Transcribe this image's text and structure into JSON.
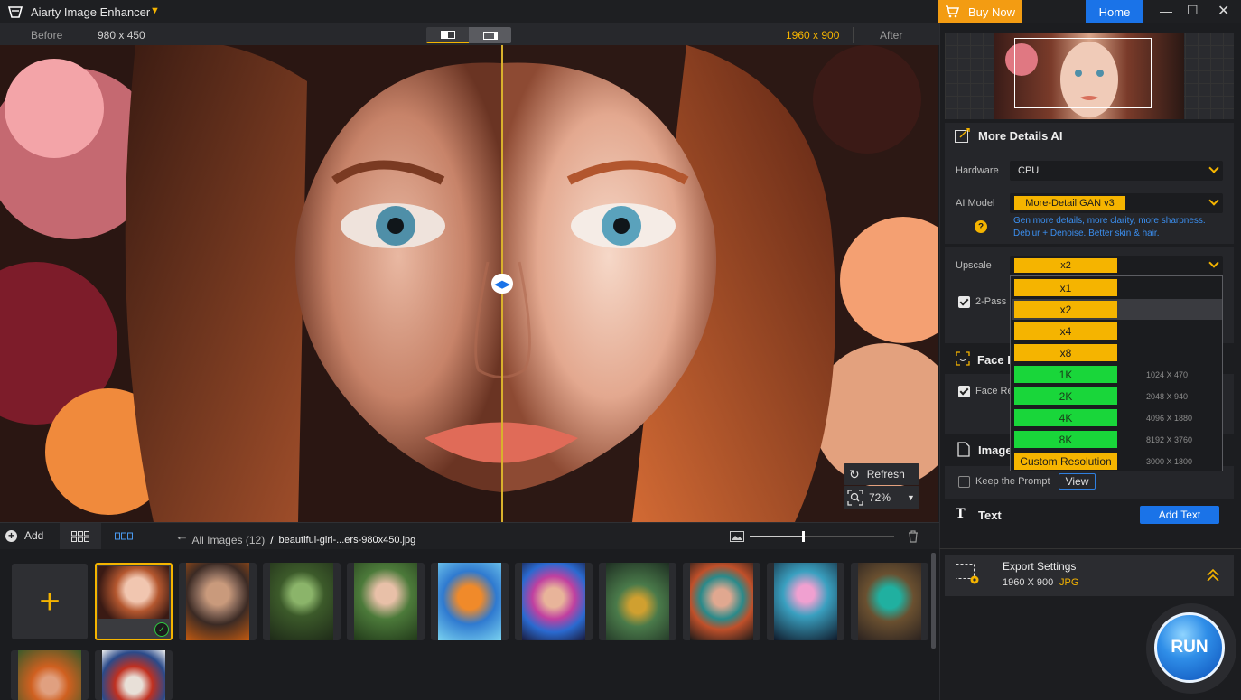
{
  "app": {
    "title": "Aiarty Image Enhancer"
  },
  "topbar": {
    "buy_now": "Buy Now",
    "home": "Home"
  },
  "compare": {
    "before_label": "Before",
    "before_size": "980 x 450",
    "after_size": "1960 x 900",
    "after_label": "After"
  },
  "preview": {
    "refresh_label": "Refresh",
    "zoom_value": "72%"
  },
  "browser": {
    "add_label": "Add",
    "breadcrumb_all": "All Images (12)",
    "breadcrumb_sep": "/",
    "breadcrumb_file": "beautiful-girl-...ers-980x450.jpg",
    "zoom_slider": 0.37
  },
  "panel": {
    "more_details_title": "More Details AI",
    "hardware_label": "Hardware",
    "hardware_value": "CPU",
    "ai_model_label": "AI Model",
    "ai_model_value": "More-Detail GAN  v3",
    "model_desc_line1": "Gen more details, more clarity, more sharpness.",
    "model_desc_line2": "Deblur + Denoise. Better skin & hair.",
    "upscale_label": "Upscale",
    "upscale_value": "x2",
    "two_pass_label": "2-Pass",
    "face_title": "Face R",
    "face_check_label": "Face Re",
    "image_title": "Image",
    "keep_prompt_label": "Keep the Prompt",
    "view_label": "View",
    "text_title": "Text",
    "add_text_label": "Add Text",
    "export_title": "Export Settings",
    "export_size": "1960 X 900",
    "export_format": "JPG",
    "run_label": "RUN"
  },
  "upscale_options": [
    {
      "label": "x1",
      "res": ""
    },
    {
      "label": "x2",
      "res": ""
    },
    {
      "label": "x4",
      "res": ""
    },
    {
      "label": "x8",
      "res": ""
    },
    {
      "label": "1K",
      "res": "1024 X 470"
    },
    {
      "label": "2K",
      "res": "2048 X 940"
    },
    {
      "label": "4K",
      "res": "4096 X 1880"
    },
    {
      "label": "8K",
      "res": "8192 X 3760"
    },
    {
      "label": "Custom Resolution",
      "res": "3000 X 1800"
    }
  ],
  "colors": {
    "accent": "#f5b400",
    "blue": "#1a73e8",
    "green": "#19d63a"
  }
}
